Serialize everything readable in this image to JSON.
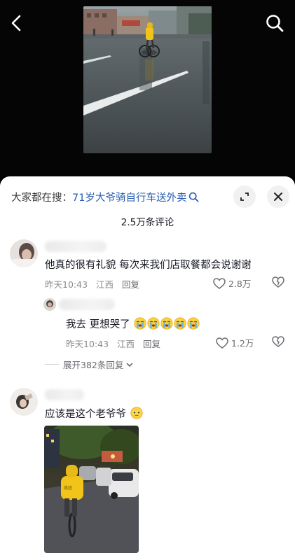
{
  "header": {
    "back_icon": "chevron-left-icon",
    "search_icon": "search-icon"
  },
  "search_hint": {
    "prefix": "大家都在搜：",
    "query": "71岁大爷骑自行车送外卖"
  },
  "comment_count": "2.5万条评论",
  "comments": [
    {
      "text": "他真的很有礼貌 每次来我们店取餐都会说谢谢",
      "time": "昨天10:43",
      "location": "江西",
      "reply_label": "回复",
      "likes": "2.8万"
    },
    {
      "text": "我去 更想哭了",
      "emoji": "crying-face",
      "emoji_count": 5,
      "time": "昨天10:43",
      "location": "江西",
      "reply_label": "回复",
      "likes": "1.2万"
    },
    {
      "text": "应该是这个老爷爷",
      "emoji": "pleading-face"
    }
  ],
  "expand_replies": "展开382条回复",
  "colors": {
    "link": "#2a5db0",
    "meta": "#8a8b91",
    "rider_jacket": "#f2c318"
  }
}
